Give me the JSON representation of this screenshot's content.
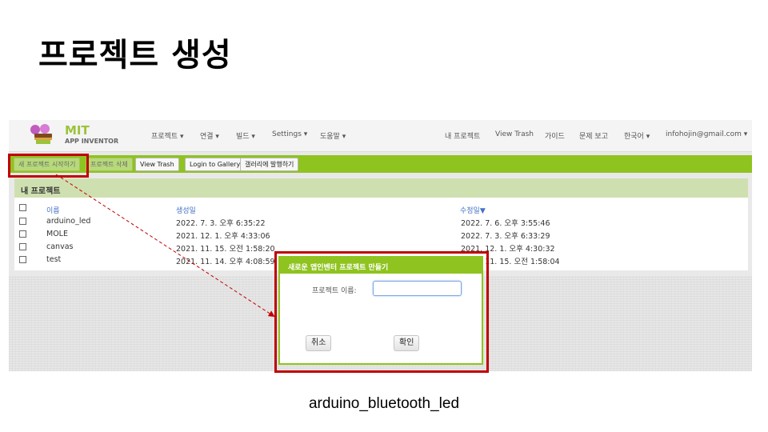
{
  "slide": {
    "title": "프로젝트 생성",
    "caption": "arduino_bluetooth_led"
  },
  "app": {
    "logo": {
      "brand": "MIT",
      "sub": "APP INVENTOR"
    },
    "top_menu": [
      "프로젝트 ▾",
      "연결 ▾",
      "빌드 ▾",
      "Settings ▾",
      "도움말 ▾"
    ],
    "right_menu": [
      "내 프로젝트",
      "View Trash",
      "가이드",
      "문제 보고",
      "한국어 ▾",
      "infohojin@gmail.com ▾"
    ],
    "toolbar": {
      "new_project": "새 프로젝트 시작하기",
      "delete_project": "프로젝트 삭제",
      "view_trash": "View Trash",
      "login_gallery": "Login to Gallery",
      "publish_gallery": "갤러리에 발행하기"
    },
    "panel_title": "내 프로젝트",
    "columns": {
      "name": "이름",
      "created": "생성일",
      "modified": "수정일▼"
    },
    "projects": [
      {
        "name": "arduino_led",
        "created": "2022. 7. 3. 오후 6:35:22",
        "modified": "2022. 7. 6. 오후 3:55:46"
      },
      {
        "name": "MOLE",
        "created": "2021. 12. 1. 오후 4:33:06",
        "modified": "2022. 7. 3. 오후 6:33:29"
      },
      {
        "name": "canvas",
        "created": "2021. 11. 15. 오전 1:58:20",
        "modified": "2021. 12. 1. 오후 4:30:32"
      },
      {
        "name": "test",
        "created": "2021. 11. 14. 오후 4:08:59",
        "modified": "2021. 11. 15. 오전 1:58:04"
      }
    ],
    "dialog": {
      "title": "새로운 앱인벤터 프로젝트 만들기",
      "field_label": "프로젝트 이름:",
      "field_value": "",
      "cancel": "취소",
      "ok": "확인"
    }
  },
  "colors": {
    "accent_green": "#8fc31f",
    "highlight_red": "#c00000",
    "link_blue": "#4472c4"
  }
}
